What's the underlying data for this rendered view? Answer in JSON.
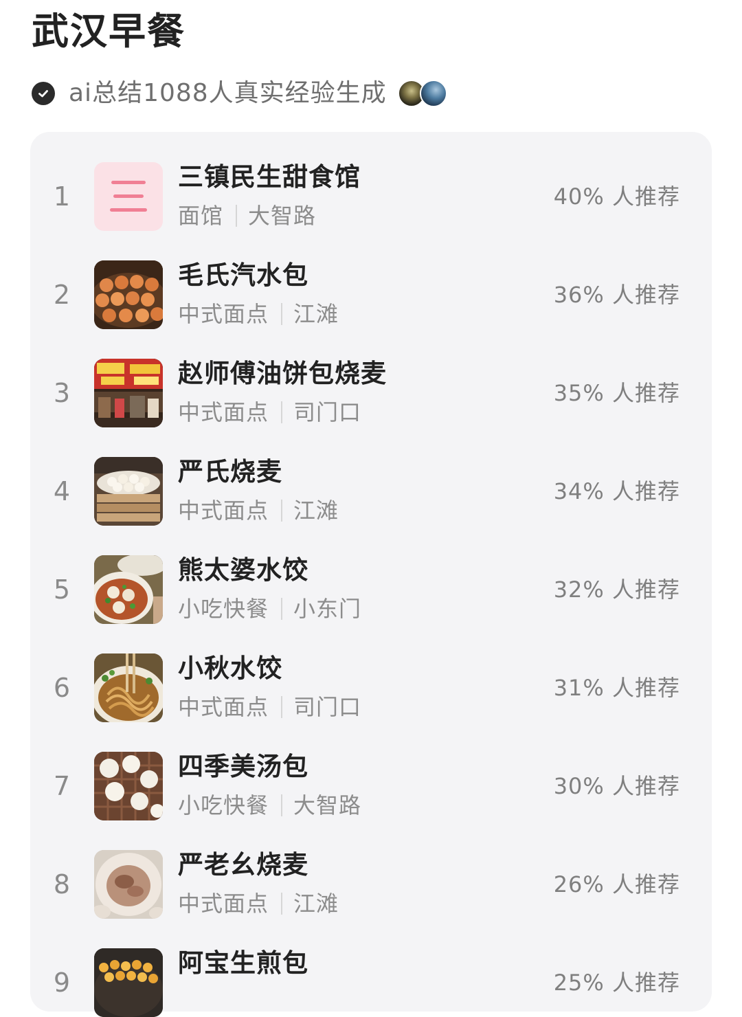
{
  "page": {
    "title": "武汉早餐",
    "subtitle": "ai总结1088人真实经验生成"
  },
  "restaurants": [
    {
      "rank": "1",
      "name": "三镇民生甜食馆",
      "category": "面馆",
      "area": "大智路",
      "percent": "40% 人推荐",
      "thumb_char": "三"
    },
    {
      "rank": "2",
      "name": "毛氏汽水包",
      "category": "中式面点",
      "area": "江滩",
      "percent": "36% 人推荐"
    },
    {
      "rank": "3",
      "name": "赵师傅油饼包烧麦",
      "category": "中式面点",
      "area": "司门口",
      "percent": "35% 人推荐"
    },
    {
      "rank": "4",
      "name": "严氏烧麦",
      "category": "中式面点",
      "area": "江滩",
      "percent": "34% 人推荐"
    },
    {
      "rank": "5",
      "name": "熊太婆水饺",
      "category": "小吃快餐",
      "area": "小东门",
      "percent": "32% 人推荐"
    },
    {
      "rank": "6",
      "name": "小秋水饺",
      "category": "中式面点",
      "area": "司门口",
      "percent": "31% 人推荐"
    },
    {
      "rank": "7",
      "name": "四季美汤包",
      "category": "小吃快餐",
      "area": "大智路",
      "percent": "30% 人推荐"
    },
    {
      "rank": "8",
      "name": "严老幺烧麦",
      "category": "中式面点",
      "area": "江滩",
      "percent": "26% 人推荐"
    },
    {
      "rank": "9",
      "name": "阿宝生煎包",
      "category": "",
      "area": "",
      "percent": "25% 人推荐"
    }
  ]
}
